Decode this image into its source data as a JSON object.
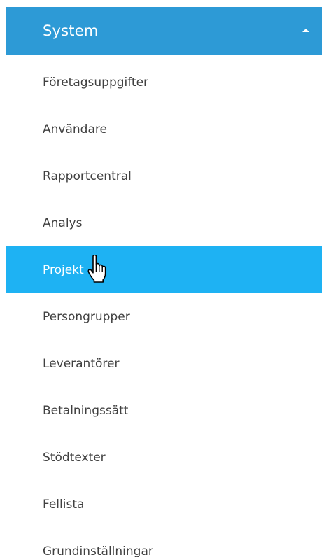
{
  "menu": {
    "title": "System",
    "expanded": true,
    "accent_color": "#2d9ad6",
    "active_color": "#1eb2f3",
    "items": [
      {
        "label": "Företagsuppgifter"
      },
      {
        "label": "Användare"
      },
      {
        "label": "Rapportcentral"
      },
      {
        "label": "Analys"
      },
      {
        "label": "Projekt",
        "active": true
      },
      {
        "label": "Persongrupper"
      },
      {
        "label": "Leverantörer"
      },
      {
        "label": "Betalningssätt"
      },
      {
        "label": "Stödtexter"
      },
      {
        "label": "Fellista"
      },
      {
        "label": "Grundinställningar"
      }
    ]
  },
  "cursor": {
    "icon": "hand-pointer-icon"
  }
}
